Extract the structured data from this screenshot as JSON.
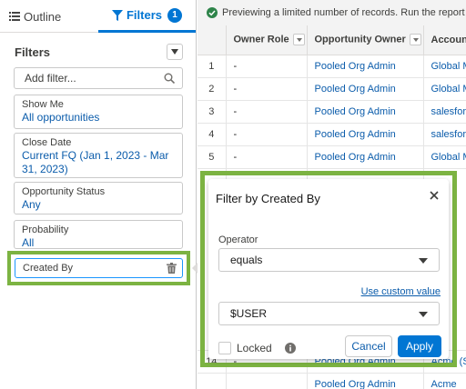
{
  "tabs": {
    "outline": "Outline",
    "filters": "Filters",
    "filters_count": "1"
  },
  "filters_panel": {
    "title": "Filters",
    "add_filter_placeholder": "Add filter...",
    "cards": [
      {
        "label": "Show Me",
        "value": "All opportunities"
      },
      {
        "label": "Close Date",
        "value": "Current FQ (Jan 1, 2023 - Mar 31, 2023)"
      },
      {
        "label": "Opportunity Status",
        "value": "Any"
      },
      {
        "label": "Probability",
        "value": "All"
      }
    ],
    "created_by": "Created By"
  },
  "banner": {
    "text": "Previewing a limited number of records. Run the report to see everything."
  },
  "grid": {
    "columns": [
      "Owner Role",
      "Opportunity Owner",
      "Account Name"
    ],
    "rows": [
      {
        "num": "1",
        "role": "-",
        "owner": "Pooled Org Admin",
        "account": "Global Media"
      },
      {
        "num": "2",
        "role": "-",
        "owner": "Pooled Org Admin",
        "account": "Global Media"
      },
      {
        "num": "3",
        "role": "-",
        "owner": "Pooled Org Admin",
        "account": "salesforce.com"
      },
      {
        "num": "4",
        "role": "-",
        "owner": "Pooled Org Admin",
        "account": "salesforce.com"
      },
      {
        "num": "5",
        "role": "-",
        "owner": "Pooled Org Admin",
        "account": "Global Media"
      }
    ],
    "last_row": {
      "num": "14",
      "role": "-",
      "owner": "Pooled Org Admin",
      "account": "Acme (Sample)"
    },
    "partial_row": {
      "owner": "Pooled Org Admin",
      "account": "Acme"
    }
  },
  "popover": {
    "title": "Filter by Created By",
    "operator_label": "Operator",
    "operator_value": "equals",
    "custom_value_link": "Use custom value",
    "value": "$USER",
    "locked_label": "Locked",
    "cancel": "Cancel",
    "apply": "Apply"
  },
  "colors": {
    "accent": "#0176d3",
    "highlight": "#7cb342",
    "link": "#0b5cab",
    "success": "#2e844a"
  }
}
